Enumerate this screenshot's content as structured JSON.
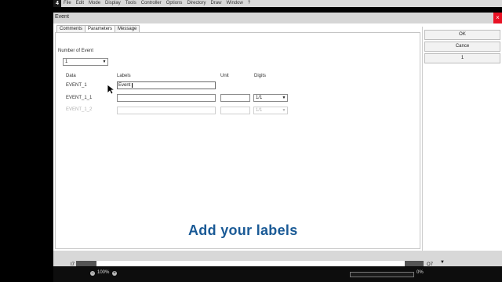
{
  "menubar": {
    "badge": "4",
    "items": [
      {
        "label": "File"
      },
      {
        "label": "Edit"
      },
      {
        "label": "Mode"
      },
      {
        "label": "Display"
      },
      {
        "label": "Tools"
      },
      {
        "label": "Controller"
      },
      {
        "label": "Options"
      },
      {
        "label": "Directory"
      },
      {
        "label": "Draw"
      },
      {
        "label": "Window"
      },
      {
        "label": "?"
      }
    ]
  },
  "dialog": {
    "title": "Event",
    "tabs": [
      "Comments",
      "Parameters",
      "Message"
    ],
    "active_tab": "Parameters",
    "buttons": {
      "ok": "OK",
      "cancel": "Cance",
      "third": "1"
    },
    "number_of_event_label": "Number of Event",
    "number_of_event_value": "1",
    "headers": {
      "data": "Data",
      "labels": "Labels",
      "unit": "Unit",
      "digits": "Digits"
    },
    "rows": [
      {
        "data": "EVENT_1",
        "label": "Event",
        "unit": "",
        "digits": ""
      },
      {
        "data": "EVENT_1_1",
        "label": "",
        "unit": "",
        "digits": "1/1"
      },
      {
        "data": "EVENT_1_2",
        "label": "",
        "unit": "",
        "digits": "1/1"
      }
    ]
  },
  "overlay": {
    "caption": "Add your labels"
  },
  "scrollbar": {
    "left_label": "I7",
    "right_label": "O7"
  },
  "status": {
    "zoom": "100%",
    "progress_text": "0%",
    "progress": 0
  }
}
